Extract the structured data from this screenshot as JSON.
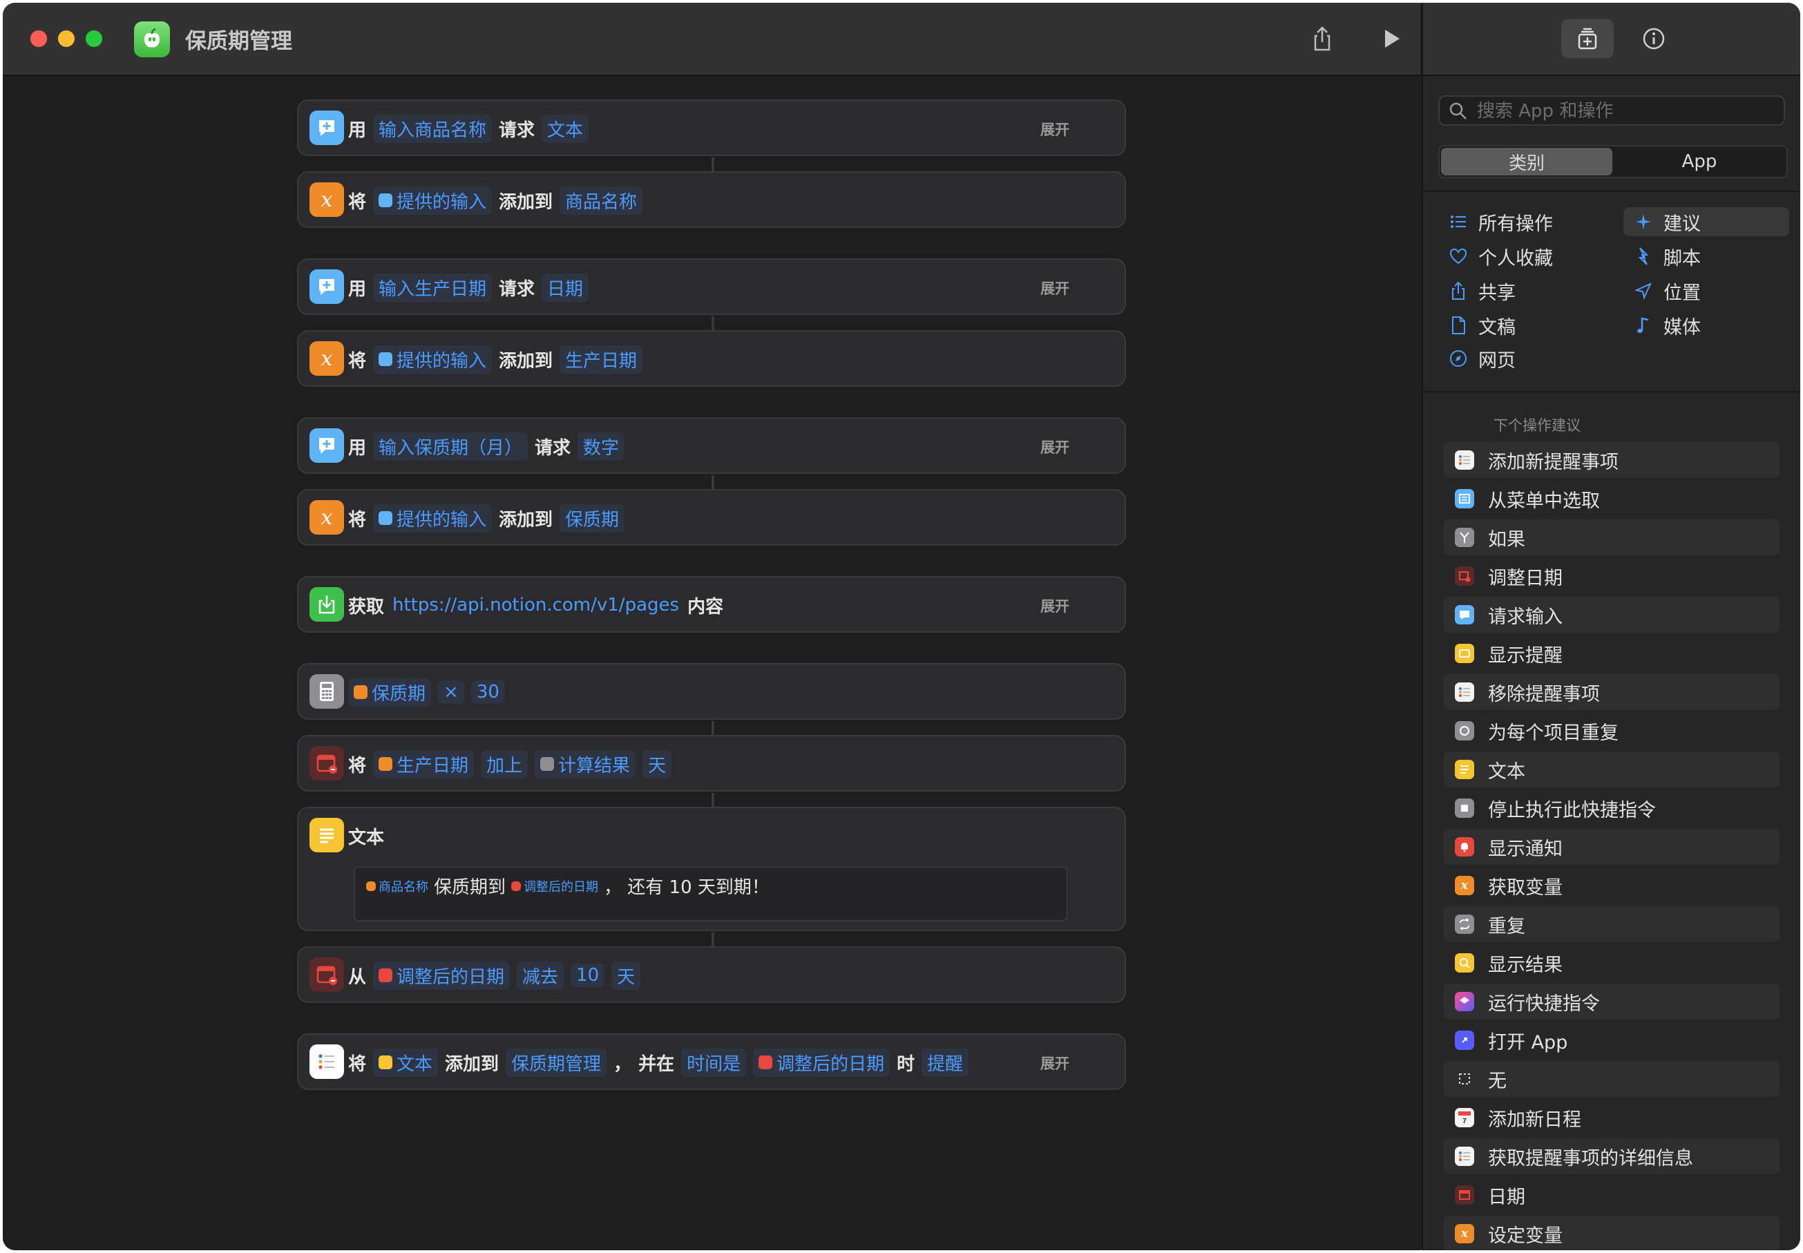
{
  "window": {
    "title": "保质期管理"
  },
  "actions": [
    {
      "verb": "用",
      "t1": "输入商品名称",
      "mid": "请求",
      "t2": "文本",
      "expand": "展开"
    },
    {
      "verb": "将",
      "t1": "提供的输入",
      "mid": "添加到",
      "t2": "商品名称"
    },
    {
      "verb": "用",
      "t1": "输入生产日期",
      "mid": "请求",
      "t2": "日期",
      "expand": "展开"
    },
    {
      "verb": "将",
      "t1": "提供的输入",
      "mid": "添加到",
      "t2": "生产日期"
    },
    {
      "verb": "用",
      "t1": "输入保质期（月）",
      "mid": "请求",
      "t2": "数字",
      "expand": "展开"
    },
    {
      "verb": "将",
      "t1": "提供的输入",
      "mid": "添加到",
      "t2": "保质期"
    },
    {
      "verb": "获取",
      "t1": "https://api.notion.com/v1/pages",
      "mid": "内容",
      "expand": "展开"
    },
    {
      "t1": "保质期",
      "op": "×",
      "t2": "30"
    },
    {
      "verb": "将",
      "t1": "生产日期",
      "op": "加上",
      "t2": "计算结果",
      "t3": "天"
    },
    {
      "verb": "文本",
      "tok1": "商品名称",
      "text1": "保质期到",
      "tok2": "调整后的日期",
      "text2": "，  还有 10 天到期！"
    },
    {
      "verb": "从",
      "t1": "调整后的日期",
      "op": "减去",
      "t2": "10",
      "t3": "天"
    },
    {
      "verb": "将",
      "t1": "文本",
      "mid": "添加到",
      "t2": "保质期管理",
      "sep": "，",
      "mid2": "并在",
      "t3": "时间是",
      "t4": "调整后的日期",
      "mid3": "时",
      "t5": "提醒",
      "expand": "展开"
    }
  ],
  "sidebar": {
    "search_placeholder": "搜索 App 和操作",
    "seg": [
      "类别",
      "App"
    ],
    "categories": [
      "所有操作",
      "建议",
      "个人收藏",
      "脚本",
      "共享",
      "位置",
      "文稿",
      "媒体",
      "网页"
    ],
    "suggest_title": "下个操作建议",
    "suggestions": [
      "添加新提醒事项",
      "从菜单中选取",
      "如果",
      "调整日期",
      "请求输入",
      "显示提醒",
      "移除提醒事项",
      "为每个项目重复",
      "文本",
      "停止执行此快捷指令",
      "显示通知",
      "获取变量",
      "重复",
      "显示结果",
      "运行快捷指令",
      "打开 App",
      "无",
      "添加新日程",
      "获取提醒事项的详细信息",
      "日期",
      "设定变量"
    ]
  }
}
